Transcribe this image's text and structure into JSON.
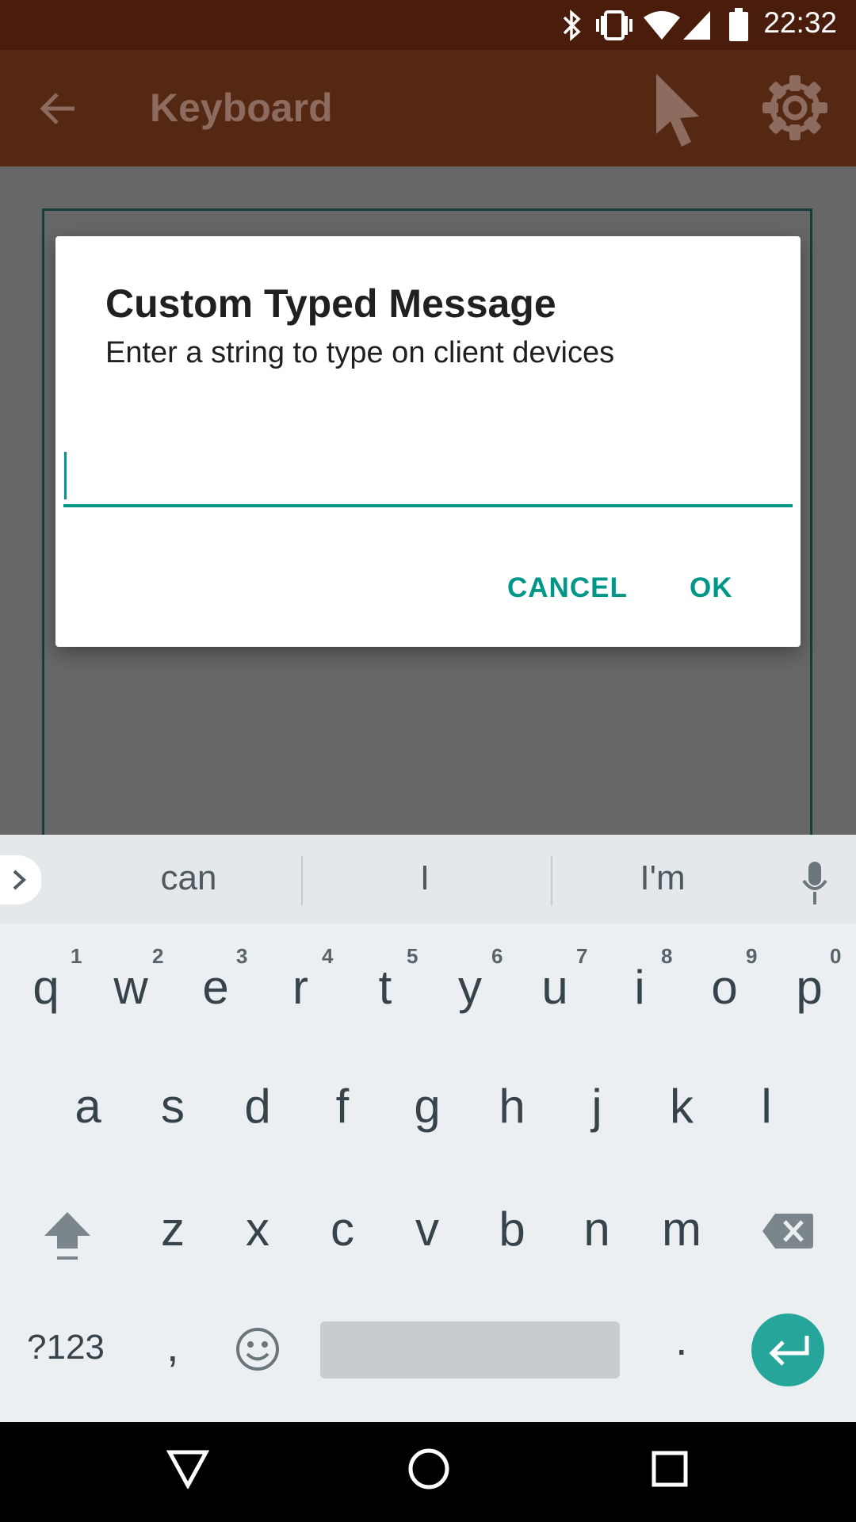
{
  "status_bar": {
    "time": "22:32"
  },
  "app_bar": {
    "title": "Keyboard"
  },
  "dialog": {
    "title": "Custom Typed Message",
    "subtitle": "Enter a string to type on client devices",
    "input_value": "",
    "cancel_label": "CANCEL",
    "ok_label": "OK"
  },
  "keyboard": {
    "suggestions": [
      "can",
      "I",
      "I'm"
    ],
    "row1": [
      "q",
      "w",
      "e",
      "r",
      "t",
      "y",
      "u",
      "i",
      "o",
      "p"
    ],
    "row1_hints": [
      "1",
      "2",
      "3",
      "4",
      "5",
      "6",
      "7",
      "8",
      "9",
      "0"
    ],
    "row2": [
      "a",
      "s",
      "d",
      "f",
      "g",
      "h",
      "j",
      "k",
      "l"
    ],
    "row3": [
      "z",
      "x",
      "c",
      "v",
      "b",
      "n",
      "m"
    ],
    "symbols_label": "?123",
    "comma": ",",
    "period": "."
  },
  "colors": {
    "accent": "#009688",
    "status_bar": "#4a1c0c",
    "app_bar": "#552814",
    "enter_key": "#26a69a"
  }
}
